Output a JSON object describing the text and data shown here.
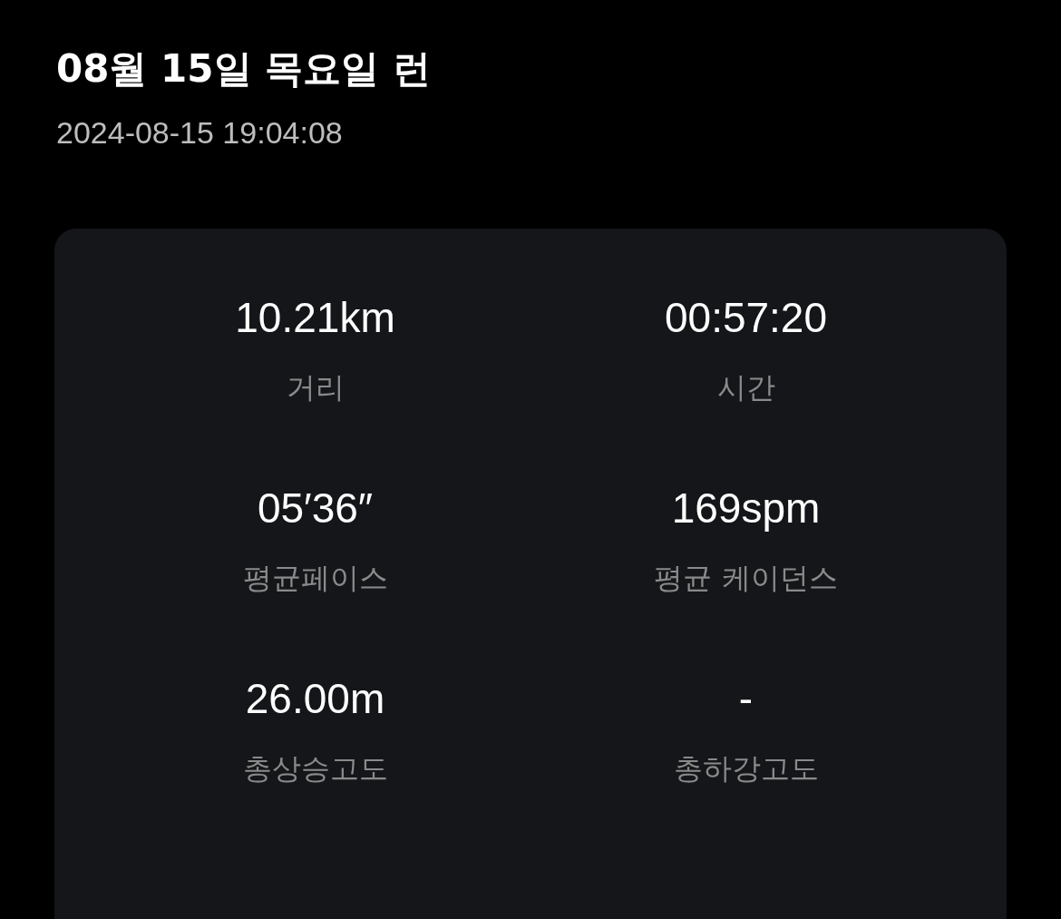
{
  "header": {
    "title": "08월 15일 목요일 런",
    "datetime": "2024-08-15 19:04:08"
  },
  "stats": [
    {
      "value": "10.21km",
      "label": "거리"
    },
    {
      "value": "00:57:20",
      "label": "시간"
    },
    {
      "value": "05′36″",
      "label": "평균페이스"
    },
    {
      "value": "169spm",
      "label": "평균 케이던스"
    },
    {
      "value": "26.00m",
      "label": "총상승고도"
    },
    {
      "value": "-",
      "label": "총하강고도"
    }
  ]
}
